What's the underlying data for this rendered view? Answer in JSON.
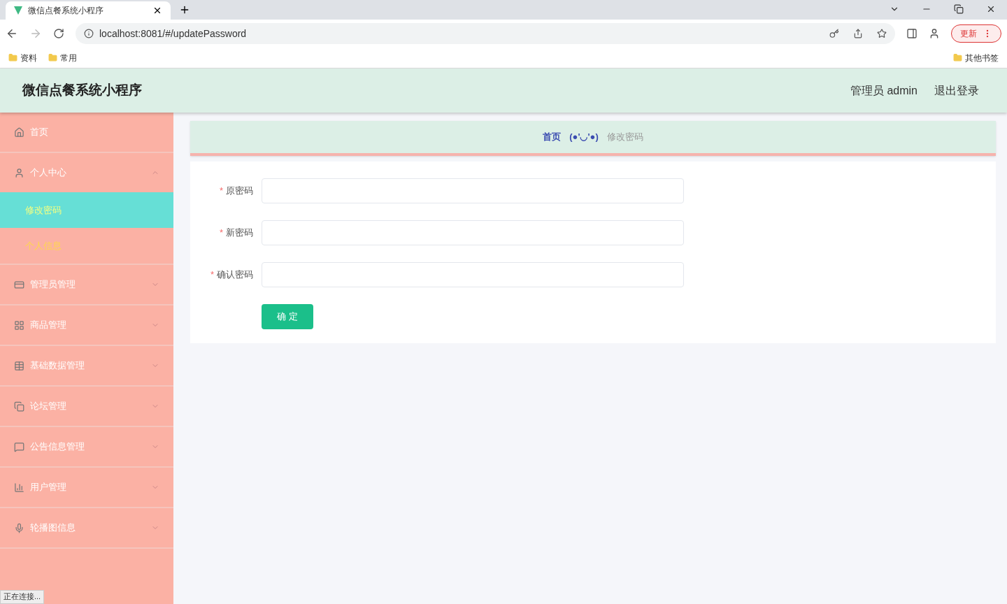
{
  "browser": {
    "tab_title": "微信点餐系统小程序",
    "url": "localhost:8081/#/updatePassword",
    "update_button": "更新",
    "bookmarks": [
      "资料",
      "常用"
    ],
    "other_bookmarks": "其他书签"
  },
  "header": {
    "title": "微信点餐系统小程序",
    "user": "管理员 admin",
    "logout": "退出登录"
  },
  "sidebar": {
    "items": [
      {
        "label": "首页"
      },
      {
        "label": "个人中心",
        "expanded": true,
        "children": [
          {
            "label": "修改密码",
            "selected": true
          },
          {
            "label": "个人信息",
            "selected": false
          }
        ]
      },
      {
        "label": "管理员管理",
        "expanded": false
      },
      {
        "label": "商品管理",
        "expanded": false
      },
      {
        "label": "基础数据管理",
        "expanded": false
      },
      {
        "label": "论坛管理",
        "expanded": false
      },
      {
        "label": "公告信息管理",
        "expanded": false
      },
      {
        "label": "用户管理",
        "expanded": false
      },
      {
        "label": "轮播图信息",
        "expanded": false
      }
    ]
  },
  "breadcrumb": {
    "home": "首页",
    "separator": "(●'◡'●)",
    "current": "修改密码"
  },
  "form": {
    "fields": [
      {
        "label": "原密码",
        "required_mark": "*"
      },
      {
        "label": "新密码",
        "required_mark": "*"
      },
      {
        "label": "确认密码",
        "required_mark": "*"
      }
    ],
    "submit": "确 定"
  },
  "status_bar": "正在连接..."
}
